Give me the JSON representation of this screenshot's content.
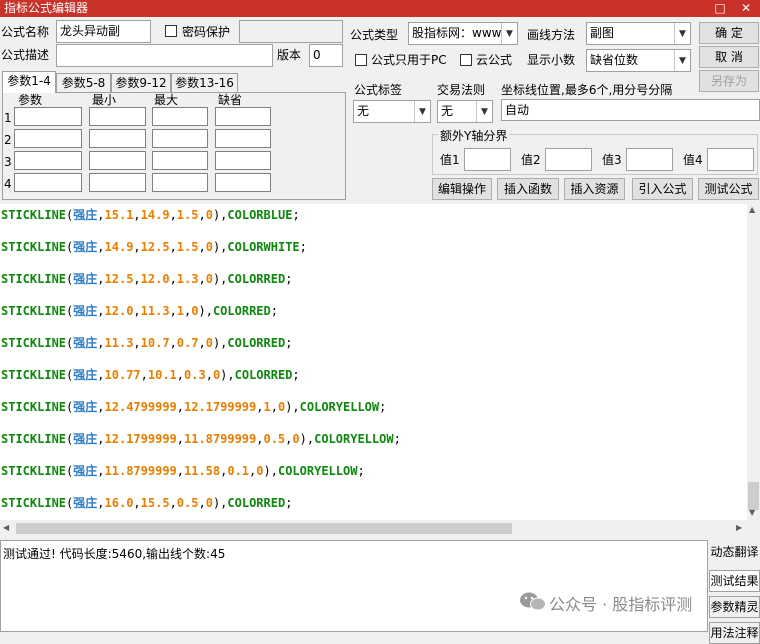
{
  "window": {
    "title": "指标公式编辑器",
    "maximize_glyph": "□",
    "close_glyph": "✕"
  },
  "form": {
    "name_label": "公式名称",
    "name_value": "龙头异动副",
    "password_label": "密码保护",
    "password_value": "",
    "desc_label": "公式描述",
    "desc_value": "",
    "version_label": "版本",
    "version_value": "0",
    "type_label": "公式类型",
    "type_value": "股指标网：www",
    "draw_label": "画线方法",
    "draw_value": "副图",
    "pc_only_label": "公式只用于PC",
    "cloud_label": "云公式",
    "decimals_label": "显示小数",
    "decimals_value": "缺省位数",
    "tag_label": "公式标签",
    "tag_value": "无",
    "trade_label": "交易法则",
    "trade_value": "无",
    "axis_label": "坐标线位置,最多6个,用分号分隔",
    "axis_value": "自动",
    "yaxis_group": "额外Y轴分界",
    "yaxis_values": [
      "值1",
      "值2",
      "值3",
      "值4"
    ]
  },
  "buttons": {
    "ok": "确  定",
    "cancel": "取  消",
    "save_as": "另存为",
    "edit": "编辑操作",
    "insert_func": "插入函数",
    "insert_res": "插入资源",
    "import": "引入公式",
    "test": "测试公式"
  },
  "params": {
    "tabs": [
      "参数1-4",
      "参数5-8",
      "参数9-12",
      "参数13-16"
    ],
    "headers": [
      "参数",
      "最小",
      "最大",
      "缺省"
    ],
    "rows": [
      "1",
      "2",
      "3",
      "4"
    ]
  },
  "code_lines": [
    {
      "fn": "STICKLINE",
      "v": "强庄",
      "a": "15.1",
      "b": "14.9",
      "c": "1.5",
      "d": "0",
      "color": "COLORBLUE"
    },
    {
      "fn": "STICKLINE",
      "v": "强庄",
      "a": "14.9",
      "b": "12.5",
      "c": "1.5",
      "d": "0",
      "color": "COLORWHITE"
    },
    {
      "fn": "STICKLINE",
      "v": "强庄",
      "a": "12.5",
      "b": "12.0",
      "c": "1.3",
      "d": "0",
      "color": "COLORRED"
    },
    {
      "fn": "STICKLINE",
      "v": "强庄",
      "a": "12.0",
      "b": "11.3",
      "c": "1",
      "d": "0",
      "color": "COLORRED"
    },
    {
      "fn": "STICKLINE",
      "v": "强庄",
      "a": "11.3",
      "b": "10.7",
      "c": "0.7",
      "d": "0",
      "color": "COLORRED"
    },
    {
      "fn": "STICKLINE",
      "v": "强庄",
      "a": "10.77",
      "b": "10.1",
      "c": "0.3",
      "d": "0",
      "color": "COLORRED"
    },
    {
      "fn": "STICKLINE",
      "v": "强庄",
      "a": "12.4799999",
      "b": "12.1799999",
      "c": "1",
      "d": "0",
      "color": "COLORYELLOW"
    },
    {
      "fn": "STICKLINE",
      "v": "强庄",
      "a": "12.1799999",
      "b": "11.8799999",
      "c": "0.5",
      "d": "0",
      "color": "COLORYELLOW"
    },
    {
      "fn": "STICKLINE",
      "v": "强庄",
      "a": "11.8799999",
      "b": "11.58",
      "c": "0.1",
      "d": "0",
      "color": "COLORYELLOW"
    },
    {
      "fn": "STICKLINE",
      "v": "强庄",
      "a": "16.0",
      "b": "15.5",
      "c": "0.5",
      "d": "0",
      "color": "COLORRED"
    }
  ],
  "status_text": "测试通过! 代码长度:5460,输出线个数:45",
  "side_buttons": [
    "动态翻译",
    "测试结果",
    "参数精灵",
    "用法注释"
  ],
  "watermark": "公众号 · 股指标评测",
  "icons": {
    "dropdown": "▼",
    "scroll_up": "▲",
    "scroll_down": "▼",
    "scroll_left": "◀",
    "scroll_right": "▶",
    "wechat": "wechat-icon"
  }
}
